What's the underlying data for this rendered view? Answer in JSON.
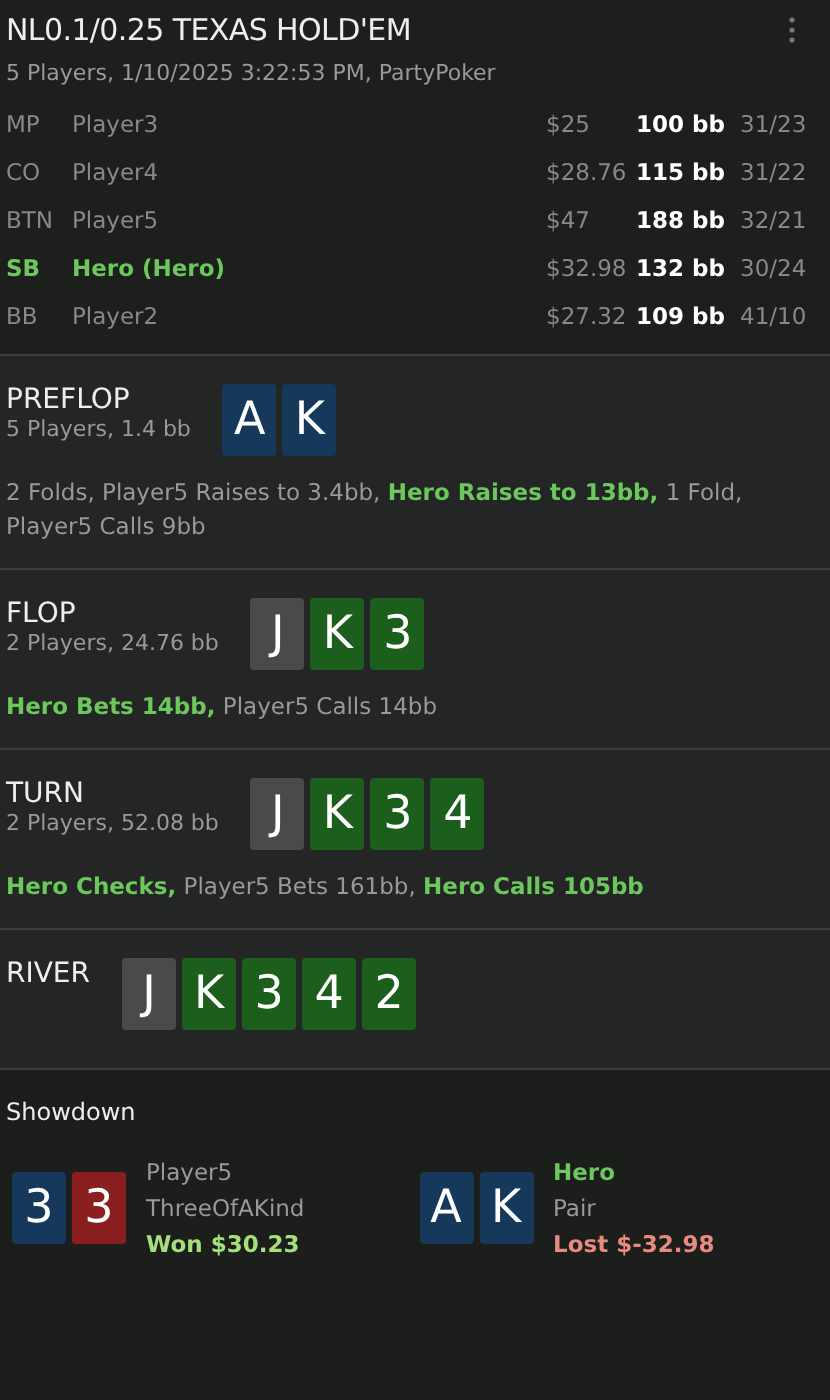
{
  "header": {
    "title": "NL0.1/0.25 TEXAS HOLD'EM",
    "subtitle": "5 Players, 1/10/2025 3:22:53 PM, PartyPoker"
  },
  "players": [
    {
      "position": "MP",
      "name": "Player3",
      "stack": "$25",
      "bb": "100 bb",
      "stats": "31/23",
      "hero": false
    },
    {
      "position": "CO",
      "name": "Player4",
      "stack": "$28.76",
      "bb": "115 bb",
      "stats": "31/22",
      "hero": false
    },
    {
      "position": "BTN",
      "name": "Player5",
      "stack": "$47",
      "bb": "188 bb",
      "stats": "32/21",
      "hero": false
    },
    {
      "position": "SB",
      "name": "Hero (Hero)",
      "stack": "$32.98",
      "bb": "132 bb",
      "stats": "30/24",
      "hero": true
    },
    {
      "position": "BB",
      "name": "Player2",
      "stack": "$27.32",
      "bb": "109 bb",
      "stats": "41/10",
      "hero": false
    }
  ],
  "streets": [
    {
      "name": "PREFLOP",
      "info": "5 Players, 1.4 bb",
      "cards": [
        {
          "rank": "A",
          "color": "#16385a"
        },
        {
          "rank": "K",
          "color": "#16385a"
        }
      ],
      "actions": [
        {
          "text": "2 Folds, Player5 Raises to 3.4bb, ",
          "hero": false
        },
        {
          "text": "Hero Raises to 13bb,",
          "hero": true
        },
        {
          "text": " 1 Fold, Player5 Calls 9bb",
          "hero": false
        }
      ]
    },
    {
      "name": "FLOP",
      "info": "2 Players, 24.76 bb",
      "cards": [
        {
          "rank": "J",
          "color": "#4a4a4a"
        },
        {
          "rank": "K",
          "color": "#1c5e1c"
        },
        {
          "rank": "3",
          "color": "#1c5e1c"
        }
      ],
      "actions": [
        {
          "text": "Hero Bets 14bb,",
          "hero": true
        },
        {
          "text": " Player5 Calls 14bb",
          "hero": false
        }
      ]
    },
    {
      "name": "TURN",
      "info": "2 Players, 52.08 bb",
      "cards": [
        {
          "rank": "J",
          "color": "#4a4a4a"
        },
        {
          "rank": "K",
          "color": "#1c5e1c"
        },
        {
          "rank": "3",
          "color": "#1c5e1c"
        },
        {
          "rank": "4",
          "color": "#1c5e1c"
        }
      ],
      "actions": [
        {
          "text": "Hero Checks,",
          "hero": true
        },
        {
          "text": " Player5 Bets 161bb, ",
          "hero": false
        },
        {
          "text": "Hero Calls 105bb",
          "hero": true
        }
      ]
    },
    {
      "name": "RIVER",
      "cards": [
        {
          "rank": "J",
          "color": "#4a4a4a"
        },
        {
          "rank": "K",
          "color": "#1c5e1c"
        },
        {
          "rank": "3",
          "color": "#1c5e1c"
        },
        {
          "rank": "4",
          "color": "#1c5e1c"
        },
        {
          "rank": "2",
          "color": "#1c5e1c"
        }
      ]
    }
  ],
  "showdown": {
    "title": "Showdown",
    "hands": [
      {
        "cards": [
          {
            "rank": "3",
            "color": "#16385a"
          },
          {
            "rank": "3",
            "color": "#8a1f1f"
          }
        ],
        "player": "Player5",
        "hero": false,
        "hand": "ThreeOfAKind",
        "result": "Won $30.23",
        "kind": "won"
      },
      {
        "cards": [
          {
            "rank": "A",
            "color": "#16385a"
          },
          {
            "rank": "K",
            "color": "#16385a"
          }
        ],
        "player": "Hero",
        "hero": true,
        "hand": "Pair",
        "result": "Lost $-32.98",
        "kind": "lost"
      }
    ]
  }
}
